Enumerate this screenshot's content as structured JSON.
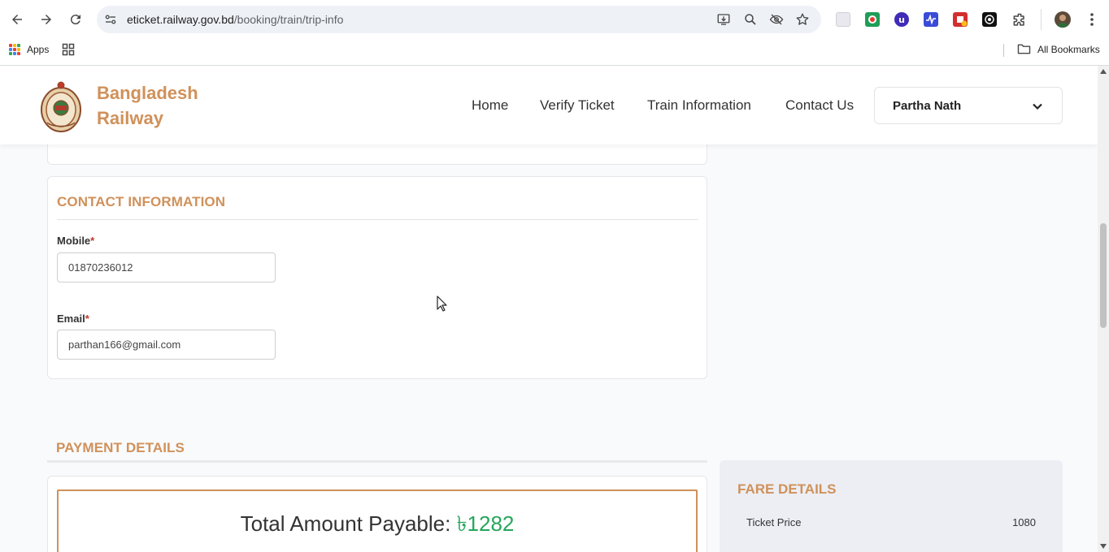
{
  "browser": {
    "url_host": "eticket.railway.gov.bd",
    "url_path": "/booking/train/trip-info",
    "bookmarks": {
      "apps_label": "Apps",
      "all_bookmarks_label": "All Bookmarks"
    },
    "icons": [
      "back-icon",
      "forward-icon",
      "reload-icon",
      "site-info-icon",
      "install-icon",
      "zoom-icon",
      "eye-off-icon",
      "star-icon",
      "extensions-icon",
      "profile-avatar",
      "kebab-menu-icon"
    ]
  },
  "header": {
    "brand_line1": "Bangladesh",
    "brand_line2": "Railway",
    "nav": {
      "home": "Home",
      "verify_ticket": "Verify Ticket",
      "train_information": "Train Information",
      "contact_us": "Contact Us"
    },
    "user_name": "Partha Nath"
  },
  "contact": {
    "title": "CONTACT INFORMATION",
    "mobile_label": "Mobile",
    "mobile_value": "01870236012",
    "email_label": "Email",
    "email_value": "parthan166@gmail.com",
    "required_mark": "*"
  },
  "payment": {
    "title": "PAYMENT DETAILS",
    "total_label": "Total Amount Payable: ",
    "total_amount": "৳1282"
  },
  "fare": {
    "title": "FARE DETAILS",
    "ticket_price_label": "Ticket Price",
    "ticket_price_value": "1080"
  },
  "colors": {
    "accent": "#d0915a",
    "amount_green": "#26a65b",
    "page_bg": "#f9fafc"
  }
}
